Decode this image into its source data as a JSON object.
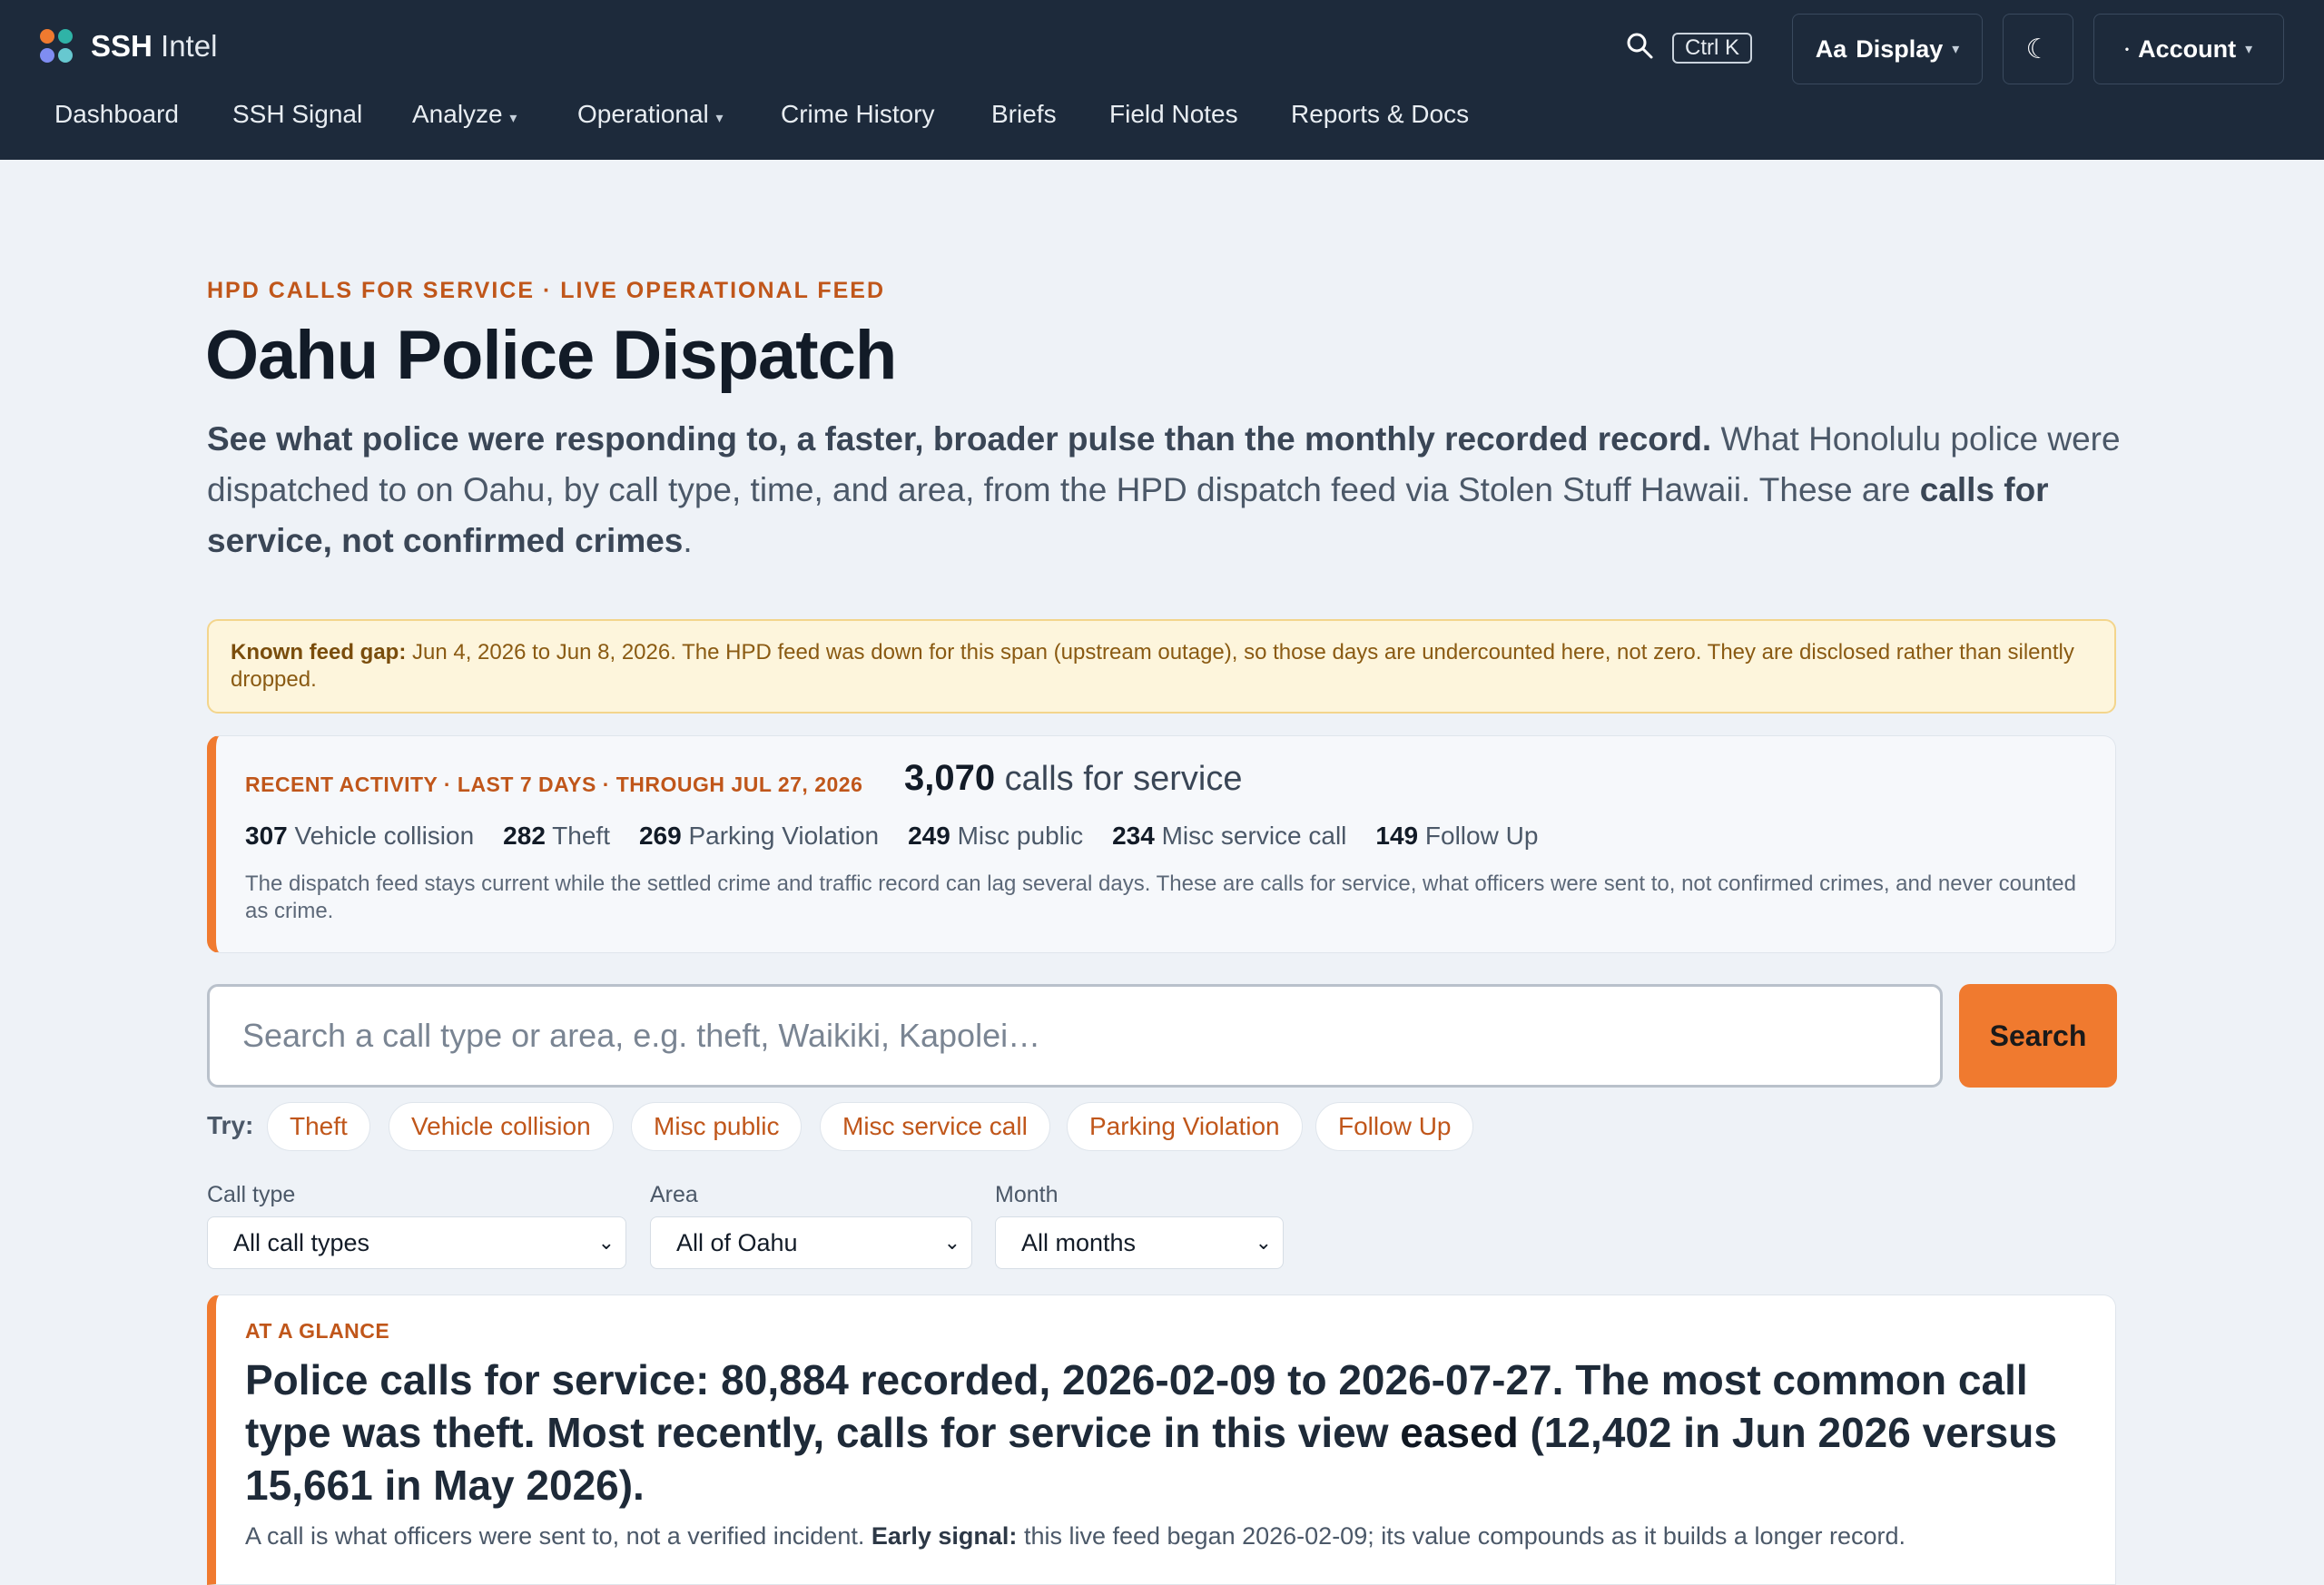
{
  "header": {
    "brand_bold": "SSH",
    "brand_light": "Intel",
    "shortcut": "Ctrl K",
    "display_label": "Display",
    "display_icon_text": "Aa",
    "theme_icon": "☾",
    "account_label": "Account"
  },
  "nav": {
    "items": [
      {
        "label": "Dashboard"
      },
      {
        "label": "SSH Signal"
      },
      {
        "label": "Analyze"
      },
      {
        "label": "Operational"
      },
      {
        "label": "Crime History"
      },
      {
        "label": "Briefs"
      },
      {
        "label": "Field Notes"
      },
      {
        "label": "Reports & Docs"
      }
    ],
    "caret": "▾"
  },
  "page": {
    "eyebrow": "HPD CALLS FOR SERVICE · LIVE OPERATIONAL FEED",
    "title": "Oahu Police Dispatch",
    "lede_bold_1": "See what police were responding to, a faster, broader pulse than the monthly recorded record.",
    "lede_text": " What Honolulu police were dispatched to on Oahu, by call type, time, and area, from the HPD dispatch feed via Stolen Stuff Hawaii. These are ",
    "lede_bold_2": "calls for service, not confirmed crimes",
    "lede_end": "."
  },
  "gap_notice": {
    "label": "Known feed gap:",
    "text": " Jun 4, 2026 to Jun 8, 2026. The HPD feed was down for this span (upstream outage), so those days are undercounted here, not zero. They are disclosed rather than silently dropped."
  },
  "recent": {
    "label": "RECENT ACTIVITY · LAST 7 DAYS · THROUGH JUL 27, 2026",
    "count": "3,070",
    "count_suffix": " calls for service",
    "types": [
      {
        "count": "307",
        "name": "Vehicle collision"
      },
      {
        "count": "282",
        "name": "Theft"
      },
      {
        "count": "269",
        "name": "Parking Violation"
      },
      {
        "count": "249",
        "name": "Misc public"
      },
      {
        "count": "234",
        "name": "Misc service call"
      },
      {
        "count": "149",
        "name": "Follow Up"
      }
    ],
    "note": "The dispatch feed stays current while the settled crime and traffic record can lag several days. These are calls for service, what officers were sent to, not confirmed crimes, and never counted as crime."
  },
  "search": {
    "placeholder": "Search a call type or area, e.g. theft, Waikiki, Kapolei…",
    "button": "Search",
    "try_label": "Try:",
    "chips": [
      "Theft",
      "Vehicle collision",
      "Misc public",
      "Misc service call",
      "Parking Violation",
      "Follow Up"
    ]
  },
  "filters": {
    "call_type_label": "Call type",
    "call_type_value": "All call types",
    "area_label": "Area",
    "area_value": "All of Oahu",
    "month_label": "Month",
    "month_value": "All months"
  },
  "glance": {
    "label": "AT A GLANCE",
    "headline_1": "Police calls for service: 80,884 recorded, 2026-02-09 to 2026-07-27. The most common call type was theft. Most recently, calls for service in this view ",
    "headline_emph": "eased",
    "headline_2": " (12,402 in Jun 2026 versus 15,661 in May 2026).",
    "sub_1": "A call is what officers were sent to, not a verified incident. ",
    "sub_bold": "Early signal:",
    "sub_2": " this live feed began 2026-02-09; its value compounds as it builds a longer record."
  }
}
